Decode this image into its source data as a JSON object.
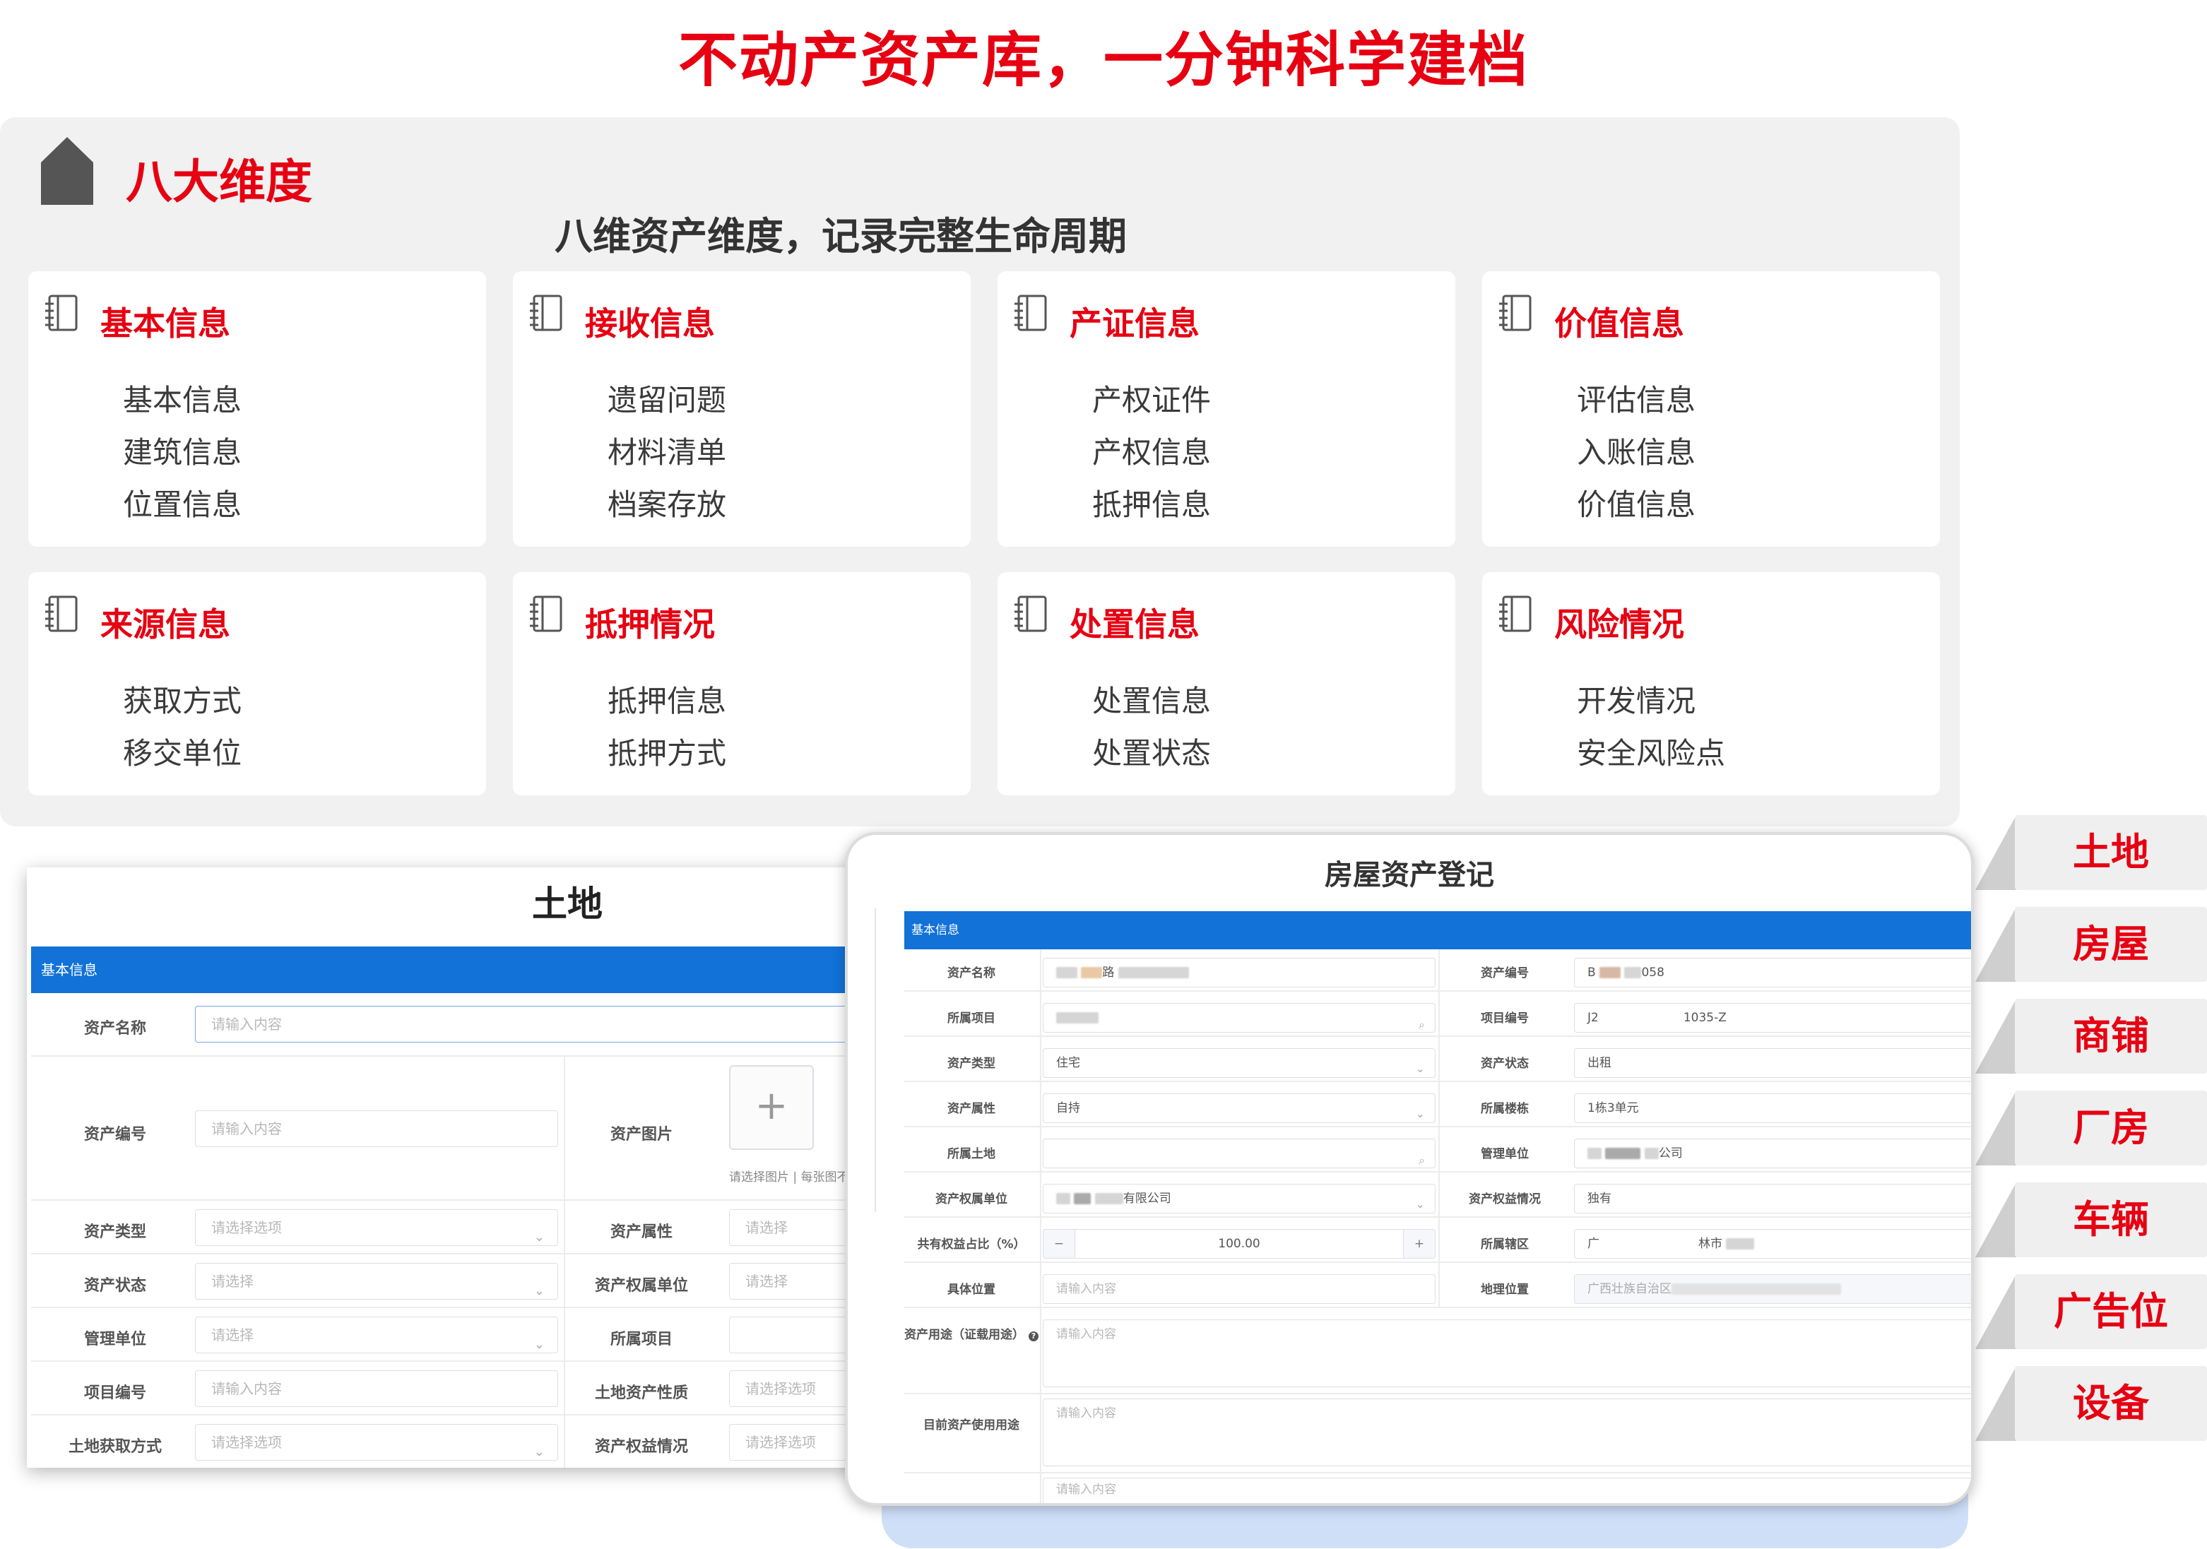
{
  "headline": "不动产资产库，一分钟科学建档",
  "dims": {
    "title": "八大维度",
    "subtitle": "八维资产维度，记录完整生命周期",
    "cards": [
      {
        "title": "基本信息",
        "items": [
          "基本信息",
          "建筑信息",
          "位置信息"
        ]
      },
      {
        "title": "接收信息",
        "items": [
          "遗留问题",
          "材料清单",
          "档案存放"
        ]
      },
      {
        "title": "产证信息",
        "items": [
          "产权证件",
          "产权信息",
          "抵押信息"
        ]
      },
      {
        "title": "价值信息",
        "items": [
          "评估信息",
          "入账信息",
          "价值信息"
        ]
      },
      {
        "title": "来源信息",
        "items": [
          "获取方式",
          "移交单位"
        ]
      },
      {
        "title": "抵押情况",
        "items": [
          "抵押信息",
          "抵押方式"
        ]
      },
      {
        "title": "处置信息",
        "items": [
          "处置信息",
          "处置状态"
        ]
      },
      {
        "title": "风险情况",
        "items": [
          "开发情况",
          "安全风险点"
        ]
      }
    ]
  },
  "categories": [
    "土地",
    "房屋",
    "商铺",
    "厂房",
    "车辆",
    "广告位",
    "设备"
  ],
  "land_form": {
    "title": "土地",
    "section": "基本信息",
    "upload_icon": "plus-icon",
    "upload_hint": "请选择图片 | 每张图不",
    "fields": {
      "asset_name": {
        "label": "资产名称",
        "placeholder": "请输入内容"
      },
      "asset_no": {
        "label": "资产编号",
        "placeholder": "请输入内容"
      },
      "asset_image": {
        "label": "资产图片"
      },
      "asset_type": {
        "label": "资产类型",
        "placeholder": "请选择选项"
      },
      "asset_attr": {
        "label": "资产属性",
        "placeholder": "请选择"
      },
      "asset_status": {
        "label": "资产状态",
        "placeholder": "请选择"
      },
      "owner_unit": {
        "label": "资产权属单位",
        "placeholder": "请选择"
      },
      "mgmt_unit": {
        "label": "管理单位",
        "placeholder": "请选择"
      },
      "project": {
        "label": "所属项目",
        "placeholder": ""
      },
      "project_no": {
        "label": "项目编号",
        "placeholder": "请输入内容"
      },
      "land_nature": {
        "label": "土地资产性质",
        "placeholder": "请选择选项"
      },
      "acquire_way": {
        "label": "土地获取方式",
        "placeholder": "请选择选项"
      },
      "equity": {
        "label": "资产权益情况",
        "placeholder": "请选择选项"
      }
    }
  },
  "house_form": {
    "title": "房屋资产登记",
    "section": "基本信息",
    "fields": {
      "asset_name": {
        "label": "资产名称",
        "value": "路"
      },
      "asset_no": {
        "label": "资产编号",
        "value": "058"
      },
      "project": {
        "label": "所属项目",
        "value": ""
      },
      "project_no": {
        "label": "项目编号",
        "value": "J2",
        "value2": "1035-Z"
      },
      "asset_type": {
        "label": "资产类型",
        "value": "住宅"
      },
      "asset_status": {
        "label": "资产状态",
        "value": "出租"
      },
      "asset_attr": {
        "label": "资产属性",
        "value": "自持"
      },
      "building": {
        "label": "所属楼栋",
        "value": "1栋3单元"
      },
      "land": {
        "label": "所属土地",
        "value": ""
      },
      "mgmt_unit": {
        "label": "管理单位",
        "value": "公司"
      },
      "owner_unit": {
        "label": "资产权属单位",
        "value": "有限公司"
      },
      "equity": {
        "label": "资产权益情况",
        "value": "独有"
      },
      "share_ratio": {
        "label": "共有权益占比（%）",
        "value": "100.00",
        "minus": "−",
        "plus": "+"
      },
      "district": {
        "label": "所属辖区",
        "value": "广",
        "value2": "林市"
      },
      "location": {
        "label": "具体位置",
        "placeholder": "请输入内容"
      },
      "geo": {
        "label": "地理位置",
        "value": "广西壮族自治区"
      },
      "usage_cert": {
        "label": "资产用途（证载用途）",
        "placeholder": "请输入内容"
      },
      "usage_now": {
        "label": "目前资产使用用途",
        "placeholder": "请输入内容"
      },
      "extra": {
        "placeholder": "请输入内容"
      }
    }
  },
  "colors": {
    "accent": "#e60012",
    "bar": "#1272d8",
    "panel": "#f1f1f1"
  }
}
